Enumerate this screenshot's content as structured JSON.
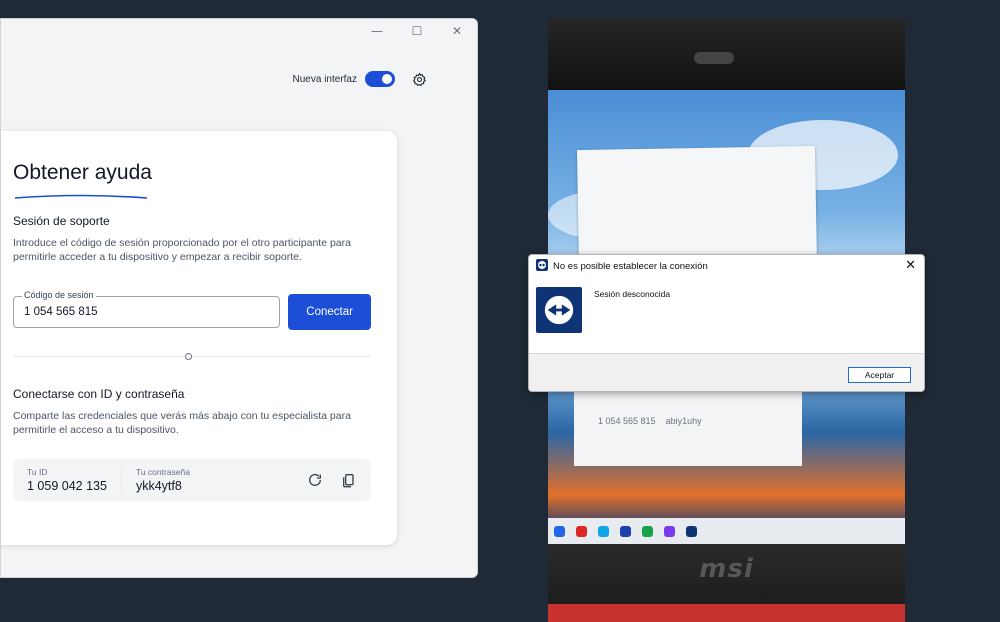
{
  "window": {
    "controls": {
      "minimize": "—",
      "maximize": "☐",
      "close": "✕"
    }
  },
  "topbar": {
    "toggle_label": "Nueva interfaz",
    "toggle_on": true,
    "accent": "#1d4ed8"
  },
  "help": {
    "title": "Obtener ayuda",
    "support_heading": "Sesión de soporte",
    "support_desc": "Introduce el código de sesión proporcionado por el otro participante para permitirle acceder a tu dispositivo y empezar a recibir soporte.",
    "session_label": "Código de sesión",
    "session_value": "1 054 565 815",
    "connect_button": "Conectar",
    "id_heading": "Conectarse con ID y contraseña",
    "id_desc": "Comparte las credenciales que verás más abajo con tu especialista para permitirle el acceso a tu dispositivo.",
    "id_label": "Tu ID",
    "id_value": "1 059 042 135",
    "password_label": "Tu contraseña",
    "password_value": "ykk4ytf8"
  },
  "photo": {
    "remote_session_code": "1 054 565 815",
    "remote_password": "abiy1uhy",
    "brand": "msi"
  },
  "dialog": {
    "title": "No es posible establecer la conexión",
    "message": "Sesión desconocida",
    "ok_button": "Aceptar",
    "brand_color": "#0e3476"
  }
}
